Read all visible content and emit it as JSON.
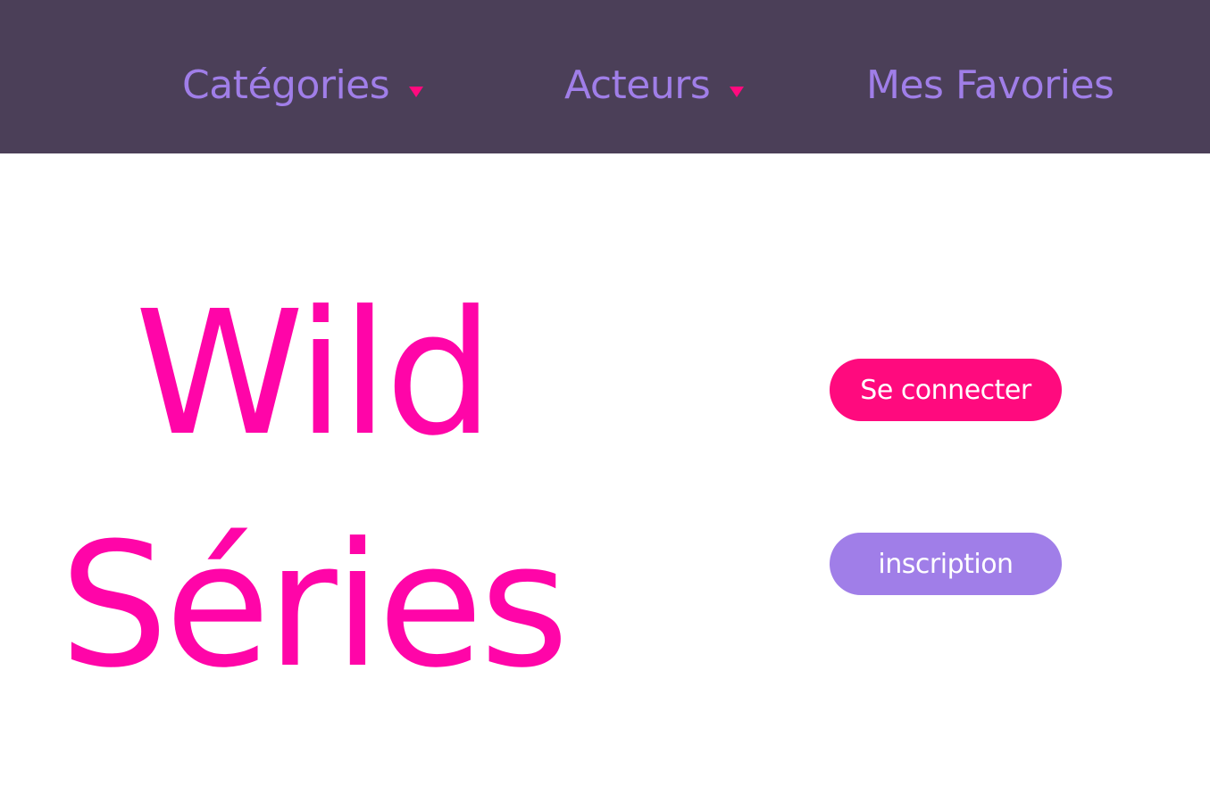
{
  "nav": {
    "categories_label": "Catégories",
    "actors_label": "Acteurs",
    "favorites_label": "Mes Favories"
  },
  "hero": {
    "title_line1": "Wild",
    "title_line2": "Séries"
  },
  "auth": {
    "login_label": "Se connecter",
    "signup_label": "inscription"
  },
  "colors": {
    "nav_background": "#4b3f58",
    "nav_text": "#a07ee8",
    "accent_pink": "#ff0a7e",
    "logo_pink": "#ff05a8",
    "signup_purple": "#a07ee8"
  },
  "icons": {
    "dropdown": "caret-down-icon"
  }
}
